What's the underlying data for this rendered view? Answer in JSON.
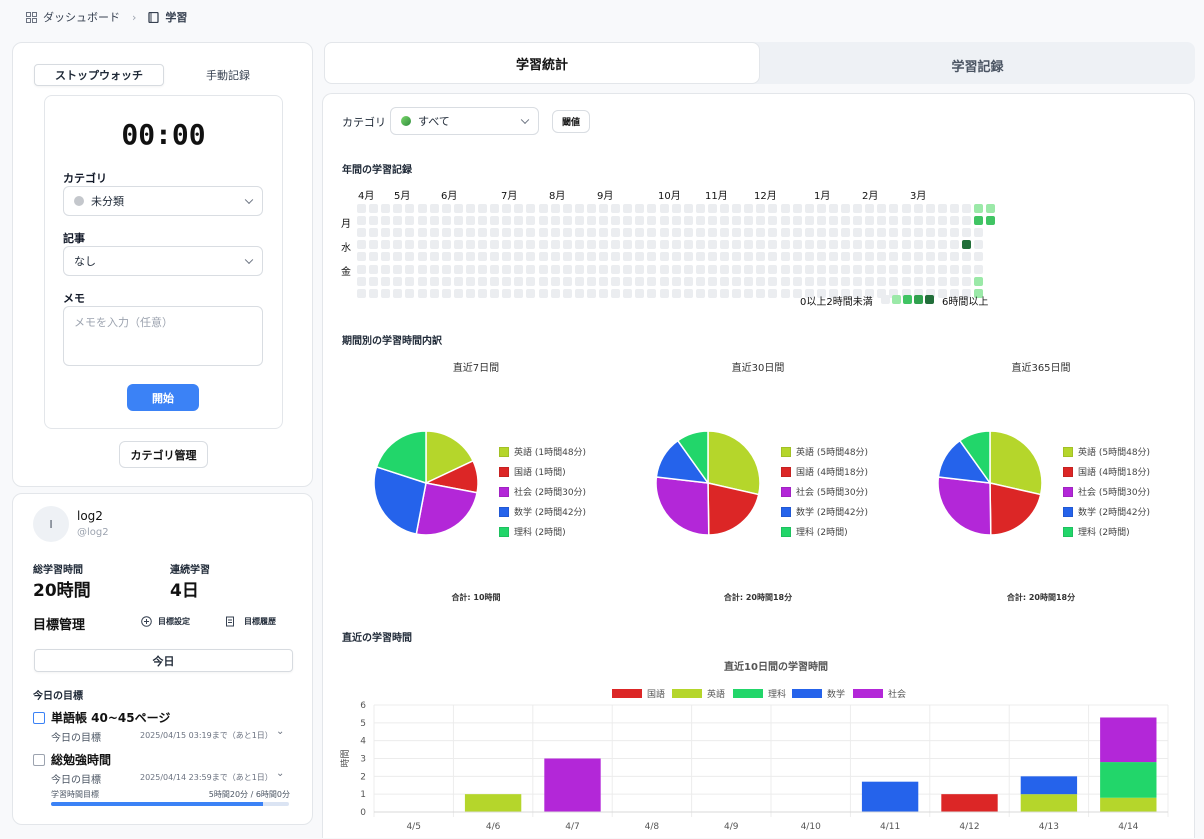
{
  "breadcrumb": {
    "home": "ダッシュボード",
    "current": "学習"
  },
  "timer": {
    "tabs": [
      "ストップウォッチ",
      "手動記録"
    ],
    "display": "00:00",
    "category_label": "カテゴリ",
    "category_value": "未分類",
    "article_label": "記事",
    "article_value": "なし",
    "memo_label": "メモ",
    "memo_placeholder": "メモを入力（任意）",
    "start_button": "開始",
    "manage_button": "カテゴリ管理"
  },
  "profile": {
    "avatar_initial": "l",
    "name": "log2",
    "handle": "@log2",
    "total_label": "総学習時間",
    "total_value": "20時間",
    "streak_label": "連続学習",
    "streak_value": "4日",
    "goals_title": "目標管理",
    "goal_set_button": "目標設定",
    "goal_history_button": "目標履歴",
    "period_tab": "今日",
    "todays_goals_title": "今日の目標",
    "goals": [
      {
        "title": "単語帳 40~45ページ",
        "sub": "今日の目標",
        "deadline": "2025/04/15 03:19まで（あと1日）"
      },
      {
        "title": "総勉強時間",
        "sub": "今日の目標",
        "deadline": "2025/04/14 23:59まで（あと1日）",
        "progress_label": "学習時間目標",
        "progress_value": "5時間20分 / 6時間0分",
        "progress": 0.889
      }
    ]
  },
  "tabs": {
    "stats": "学習統計",
    "records": "学習記録"
  },
  "filters": {
    "category_label": "カテゴリ",
    "category_value": "すべて",
    "threshold_button": "閾値"
  },
  "heatmap": {
    "title": "年間の学習記録",
    "months": [
      "4月",
      "5月",
      "6月",
      "7月",
      "8月",
      "9月",
      "10月",
      "11月",
      "12月",
      "1月",
      "2月",
      "3月"
    ],
    "days": [
      "月",
      "水",
      "金"
    ],
    "legend_low": "0以上2時間未満",
    "legend_high": "6時間以上",
    "colors": [
      "#ebedf0",
      "#9be9a8",
      "#40c463",
      "#30a14e",
      "#216e39"
    ],
    "active_cells": [
      {
        "week": 51,
        "day": 0,
        "level": 1
      },
      {
        "week": 51,
        "day": 1,
        "level": 2
      },
      {
        "week": 50,
        "day": 3,
        "level": 4
      },
      {
        "week": 51,
        "day": 6,
        "level": 1
      },
      {
        "week": 51,
        "day": 7,
        "level": 1
      },
      {
        "week": 52,
        "day": 0,
        "level": 1
      },
      {
        "week": 52,
        "day": 1,
        "level": 2
      }
    ]
  },
  "breakdown": {
    "title": "期間別の学習時間内訳"
  },
  "recent": {
    "title": "直近の学習時間"
  },
  "colors": {
    "国語": "#dc2626",
    "英語": "#b5d62b",
    "理科": "#22d66a",
    "数学": "#2563eb",
    "社会": "#b327d8"
  },
  "chart_data": [
    {
      "type": "pie",
      "title": "直近7日間",
      "labels": [
        "英語 (1時間48分)",
        "国語 (1時間)",
        "社会 (2時間30分)",
        "数学 (2時間42分)",
        "理科 (2時間)"
      ],
      "values": [
        108,
        60,
        150,
        162,
        120
      ],
      "colors": [
        "#b5d62b",
        "#dc2626",
        "#b327d8",
        "#2563eb",
        "#22d66a"
      ],
      "total": "合計: 10時間"
    },
    {
      "type": "pie",
      "title": "直近30日間",
      "labels": [
        "英語 (5時間48分)",
        "国語 (4時間18分)",
        "社会 (5時間30分)",
        "数学 (2時間42分)",
        "理科 (2時間)"
      ],
      "values": [
        348,
        258,
        330,
        162,
        120
      ],
      "colors": [
        "#b5d62b",
        "#dc2626",
        "#b327d8",
        "#2563eb",
        "#22d66a"
      ],
      "total": "合計: 20時間18分"
    },
    {
      "type": "pie",
      "title": "直近365日間",
      "labels": [
        "英語 (5時間48分)",
        "国語 (4時間18分)",
        "社会 (5時間30分)",
        "数学 (2時間42分)",
        "理科 (2時間)"
      ],
      "values": [
        348,
        258,
        330,
        162,
        120
      ],
      "colors": [
        "#b5d62b",
        "#dc2626",
        "#b327d8",
        "#2563eb",
        "#22d66a"
      ],
      "total": "合計: 20時間18分"
    },
    {
      "type": "bar",
      "stacked": true,
      "title": "直近10日間の学習時間",
      "ylabel": "時間",
      "ylim": [
        0,
        6
      ],
      "yticks": [
        "0",
        "1",
        "2",
        "3",
        "4",
        "5",
        "6"
      ],
      "categories": [
        "4/5",
        "4/6",
        "4/7",
        "4/8",
        "4/9",
        "4/10",
        "4/11",
        "4/12",
        "4/13",
        "4/14"
      ],
      "legend_position": "top",
      "grid": true,
      "series": [
        {
          "name": "国語",
          "color": "#dc2626",
          "values": [
            0,
            0,
            0,
            0,
            0,
            0,
            0,
            1.0,
            0,
            0
          ]
        },
        {
          "name": "英語",
          "color": "#b5d62b",
          "values": [
            0,
            1.0,
            0,
            0,
            0,
            0,
            0,
            0,
            1.0,
            0.8
          ]
        },
        {
          "name": "理科",
          "color": "#22d66a",
          "values": [
            0,
            0,
            0,
            0,
            0,
            0,
            0,
            0,
            0,
            2.0
          ]
        },
        {
          "name": "数学",
          "color": "#2563eb",
          "values": [
            0,
            0,
            0,
            0,
            0,
            0,
            1.7,
            0,
            1.0,
            0
          ]
        },
        {
          "name": "社会",
          "color": "#b327d8",
          "values": [
            0,
            0,
            3.0,
            0,
            0,
            0,
            0,
            0,
            0,
            2.5
          ]
        }
      ]
    }
  ]
}
